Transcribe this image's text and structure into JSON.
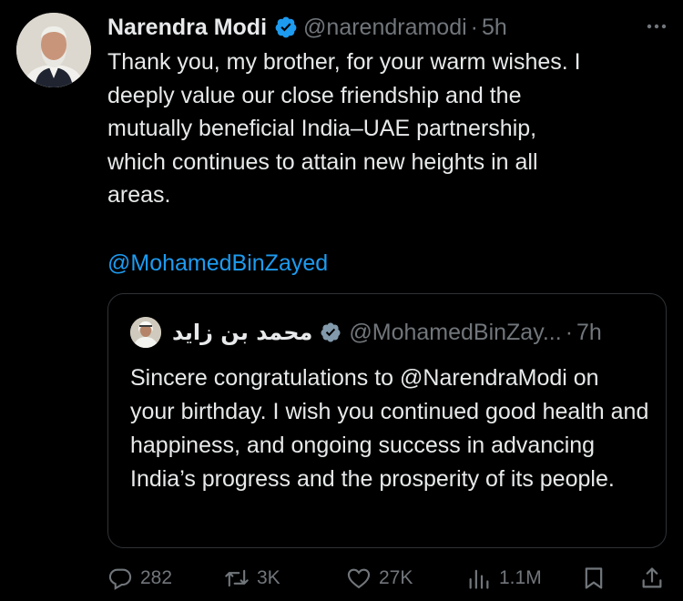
{
  "author": {
    "name": "Narendra Modi",
    "handle": "@narendramodi",
    "time": "5h",
    "separator": "·"
  },
  "tweet": {
    "text": "Thank you, my brother, for your warm wishes. I\ndeeply value our close friendship and the\nmutually beneficial India–UAE partnership,\nwhich continues to attain new heights in all\nareas.",
    "mention": "@MohamedBinZayed"
  },
  "quoted": {
    "name": "محمد بن زايد",
    "handle": "@MohamedBinZay...",
    "time": "7h",
    "separator": "·",
    "text_before": "Sincere congratulations to ",
    "text_mention": "@NarendraModi",
    "text_after": " on your birthday. I wish you continued good health and happiness, and ongoing success in advancing India’s progress and the prosperity of its people."
  },
  "actions": {
    "replies": "282",
    "reposts": "3K",
    "likes": "27K",
    "views": "1.1M"
  },
  "icons": {
    "verified": "verified-badge-icon",
    "more": "more-options-icon",
    "reply": "reply-icon",
    "repost": "repost-icon",
    "like": "like-icon",
    "views": "views-icon",
    "bookmark": "bookmark-icon",
    "share": "share-icon"
  },
  "colors": {
    "background": "#000000",
    "text": "#e7e9ea",
    "secondary": "#71767b",
    "link": "#1d9bf0",
    "verified": "#1d9bf0",
    "border": "#2f3336"
  }
}
